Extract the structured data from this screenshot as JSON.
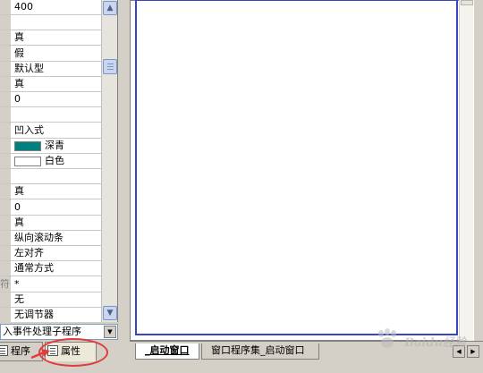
{
  "properties": {
    "rows": [
      {
        "name": "",
        "value": "400"
      },
      {
        "name": "",
        "value": ""
      },
      {
        "name": "",
        "value": "真"
      },
      {
        "name": "",
        "value": "假"
      },
      {
        "name": "",
        "value": "默认型"
      },
      {
        "name": "",
        "value": "真"
      },
      {
        "name": "",
        "value": "0"
      },
      {
        "name": "",
        "value": ""
      },
      {
        "name": "",
        "value": "凹入式"
      },
      {
        "name": "",
        "value": "深青",
        "swatch": "#008080"
      },
      {
        "name": "",
        "value": "白色",
        "swatch": "#ffffff"
      },
      {
        "name": "",
        "value": ""
      },
      {
        "name": "",
        "value": "真"
      },
      {
        "name": "",
        "value": "0"
      },
      {
        "name": "",
        "value": "真"
      },
      {
        "name": "",
        "value": "纵向滚动条"
      },
      {
        "name": "",
        "value": "左对齐"
      },
      {
        "name": "",
        "value": "通常方式"
      },
      {
        "name": "符",
        "value": "*"
      },
      {
        "name": "",
        "value": "无"
      },
      {
        "name": "",
        "value": "无调节器"
      }
    ]
  },
  "event_dropdown": {
    "text": "入事件处理子程序"
  },
  "left_tabs": [
    {
      "label": "程序"
    },
    {
      "label": "属性"
    }
  ],
  "editor_tabs": [
    {
      "label": "_启动窗口"
    },
    {
      "label": "窗口程序集_启动窗口"
    }
  ],
  "watermark": {
    "text": "Baidu经验"
  },
  "colors": {
    "highlight": "#e23b3b",
    "canvas_border": "#3a45c4"
  }
}
